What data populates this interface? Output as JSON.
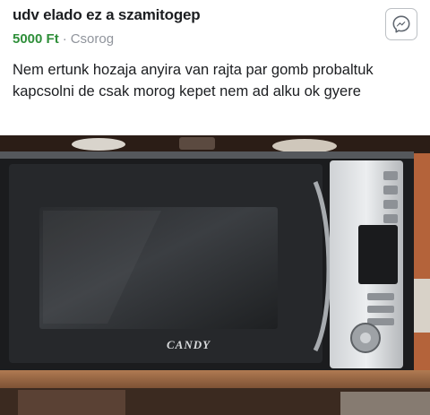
{
  "post": {
    "title": "udv elado ez a szamitogep",
    "price": "5000 Ft",
    "separator": "·",
    "location": "Csorog",
    "description": "Nem ertunk hozaja anyira van rajta par gomb probaltuk kapcsolni de csak morog kepet nem ad alku ok gyere"
  },
  "photo": {
    "brand_logo": "CANDY",
    "subject": "microwave-oven"
  },
  "icons": {
    "message": "messenger-icon"
  }
}
